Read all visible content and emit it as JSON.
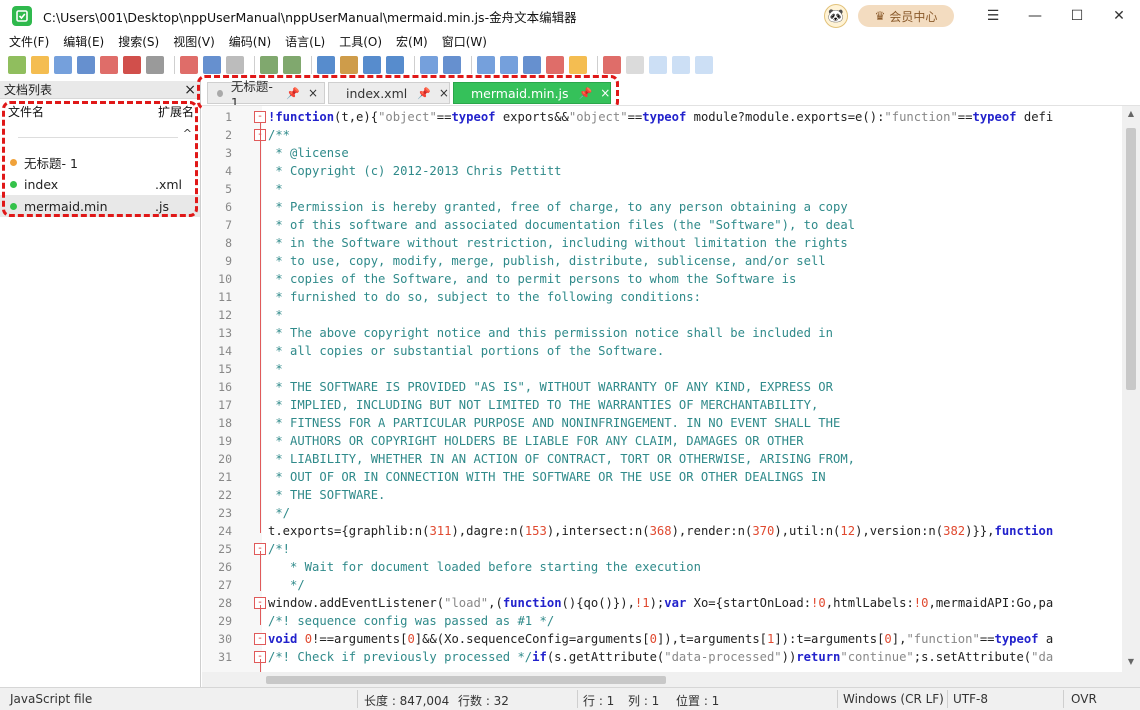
{
  "window": {
    "title": "C:\\Users\\001\\Desktop\\nppUserManual\\nppUserManual\\mermaid.min.js-金舟文本编辑器",
    "vip_label": "会员中心",
    "controls": {
      "menu": "☰",
      "minimize": "—",
      "maximize": "☐",
      "close": "✕"
    }
  },
  "menu": [
    "文件(F)",
    "编辑(E)",
    "搜索(S)",
    "视图(V)",
    "编码(N)",
    "语言(L)",
    "工具(O)",
    "宏(M)",
    "窗口(W)"
  ],
  "toolbar_icons": [
    "new-icon",
    "open-icon",
    "save-icon",
    "save-all-icon",
    "close-icon",
    "close-all-icon",
    "print-icon",
    "cut-icon",
    "copy-icon",
    "paste-icon",
    "undo-icon",
    "redo-icon",
    "find-icon",
    "replace-icon",
    "zoom-in-icon",
    "zoom-out-icon",
    "sync-icon",
    "pilcrow-icon",
    "indent-guide-icon",
    "word-wrap-icon",
    "doc-map-icon",
    "function-list-icon",
    "folder-icon",
    "record-macro-icon",
    "stop-macro-icon",
    "play-macro-icon",
    "run-macro-icon",
    "save-macro-icon"
  ],
  "doclist": {
    "title": "文档列表",
    "close": "×",
    "col_name": "文件名",
    "col_ext": "扩展名",
    "caret": "^",
    "items": [
      {
        "name": "无标题- 1",
        "ext": "",
        "status": "unsaved"
      },
      {
        "name": "index",
        "ext": ".xml",
        "status": "saved"
      },
      {
        "name": "mermaid.min",
        "ext": ".js",
        "status": "saved"
      }
    ]
  },
  "tabs": [
    {
      "label": "无标题- 1",
      "pin": "📌",
      "close": "×",
      "active": false
    },
    {
      "label": "index.xml",
      "pin": "📌",
      "close": "×",
      "active": false
    },
    {
      "label": "mermaid.min.js",
      "pin": "📌",
      "close": "×",
      "active": true
    }
  ],
  "editor_lines": [
    {
      "n": "1",
      "fold": "-",
      "parts": [
        [
          "c-kw",
          "!function"
        ],
        [
          "c-black",
          "(t,e){"
        ],
        [
          "c-str",
          "\"object\""
        ],
        [
          "c-black",
          "=="
        ],
        [
          "c-kw",
          "typeof"
        ],
        [
          "c-black",
          " exports&&"
        ],
        [
          "c-str",
          "\"object\""
        ],
        [
          "c-black",
          "=="
        ],
        [
          "c-kw",
          "typeof"
        ],
        [
          "c-black",
          " module?module.exports=e():"
        ],
        [
          "c-str",
          "\"function\""
        ],
        [
          "c-black",
          "=="
        ],
        [
          "c-kw",
          "typeof"
        ],
        [
          "c-black",
          " defi"
        ]
      ]
    },
    {
      "n": "2",
      "fold": "-",
      "parts": [
        [
          "c-cmt",
          "/**"
        ]
      ]
    },
    {
      "n": "3",
      "parts": [
        [
          "c-cmt",
          " * @license"
        ]
      ]
    },
    {
      "n": "4",
      "parts": [
        [
          "c-cmt",
          " * Copyright (c) 2012-2013 Chris Pettitt"
        ]
      ]
    },
    {
      "n": "5",
      "parts": [
        [
          "c-cmt",
          " *"
        ]
      ]
    },
    {
      "n": "6",
      "parts": [
        [
          "c-cmt",
          " * Permission is hereby granted, free of charge, to any person obtaining a copy"
        ]
      ]
    },
    {
      "n": "7",
      "parts": [
        [
          "c-cmt",
          " * of this software and associated documentation files (the \"Software\"), to deal"
        ]
      ]
    },
    {
      "n": "8",
      "parts": [
        [
          "c-cmt",
          " * in the Software without restriction, including without limitation the rights"
        ]
      ]
    },
    {
      "n": "9",
      "parts": [
        [
          "c-cmt",
          " * to use, copy, modify, merge, publish, distribute, sublicense, and/or sell"
        ]
      ]
    },
    {
      "n": "10",
      "parts": [
        [
          "c-cmt",
          " * copies of the Software, and to permit persons to whom the Software is"
        ]
      ]
    },
    {
      "n": "11",
      "parts": [
        [
          "c-cmt",
          " * furnished to do so, subject to the following conditions:"
        ]
      ]
    },
    {
      "n": "12",
      "parts": [
        [
          "c-cmt",
          " *"
        ]
      ]
    },
    {
      "n": "13",
      "parts": [
        [
          "c-cmt",
          " * The above copyright notice and this permission notice shall be included in"
        ]
      ]
    },
    {
      "n": "14",
      "parts": [
        [
          "c-cmt",
          " * all copies or substantial portions of the Software."
        ]
      ]
    },
    {
      "n": "15",
      "parts": [
        [
          "c-cmt",
          " *"
        ]
      ]
    },
    {
      "n": "16",
      "parts": [
        [
          "c-cmt",
          " * THE SOFTWARE IS PROVIDED \"AS IS\", WITHOUT WARRANTY OF ANY KIND, EXPRESS OR"
        ]
      ]
    },
    {
      "n": "17",
      "parts": [
        [
          "c-cmt",
          " * IMPLIED, INCLUDING BUT NOT LIMITED TO THE WARRANTIES OF MERCHANTABILITY,"
        ]
      ]
    },
    {
      "n": "18",
      "parts": [
        [
          "c-cmt",
          " * FITNESS FOR A PARTICULAR PURPOSE AND NONINFRINGEMENT. IN NO EVENT SHALL THE"
        ]
      ]
    },
    {
      "n": "19",
      "parts": [
        [
          "c-cmt",
          " * AUTHORS OR COPYRIGHT HOLDERS BE LIABLE FOR ANY CLAIM, DAMAGES OR OTHER"
        ]
      ]
    },
    {
      "n": "20",
      "parts": [
        [
          "c-cmt",
          " * LIABILITY, WHETHER IN AN ACTION OF CONTRACT, TORT OR OTHERWISE, ARISING FROM,"
        ]
      ]
    },
    {
      "n": "21",
      "parts": [
        [
          "c-cmt",
          " * OUT OF OR IN CONNECTION WITH THE SOFTWARE OR THE USE OR OTHER DEALINGS IN"
        ]
      ]
    },
    {
      "n": "22",
      "parts": [
        [
          "c-cmt",
          " * THE SOFTWARE."
        ]
      ]
    },
    {
      "n": "23",
      "parts": [
        [
          "c-cmt",
          " */"
        ]
      ]
    },
    {
      "n": "24",
      "parts": [
        [
          "c-black",
          "t.exports={graphlib:n("
        ],
        [
          "c-num",
          "311"
        ],
        [
          "c-black",
          "),dagre:n("
        ],
        [
          "c-num",
          "153"
        ],
        [
          "c-black",
          "),intersect:n("
        ],
        [
          "c-num",
          "368"
        ],
        [
          "c-black",
          "),render:n("
        ],
        [
          "c-num",
          "370"
        ],
        [
          "c-black",
          "),util:n("
        ],
        [
          "c-num",
          "12"
        ],
        [
          "c-black",
          "),version:n("
        ],
        [
          "c-num",
          "382"
        ],
        [
          "c-black",
          ")}},"
        ],
        [
          "c-kw",
          "function"
        ]
      ]
    },
    {
      "n": "25",
      "fold": "-",
      "parts": [
        [
          "c-cmt",
          "/*!"
        ]
      ]
    },
    {
      "n": "26",
      "parts": [
        [
          "c-cmt",
          "   * Wait for document loaded before starting the execution"
        ]
      ]
    },
    {
      "n": "27",
      "parts": [
        [
          "c-cmt",
          "   */"
        ]
      ]
    },
    {
      "n": "28",
      "fold": "-",
      "parts": [
        [
          "c-black",
          "window.addEventListener("
        ],
        [
          "c-str",
          "\"load\""
        ],
        [
          "c-black",
          ",("
        ],
        [
          "c-kw",
          "function"
        ],
        [
          "c-black",
          "(){qo()}),"
        ],
        [
          "c-num",
          "!1"
        ],
        [
          "c-black",
          ");"
        ],
        [
          "c-kw",
          "var"
        ],
        [
          "c-black",
          " Xo={startOnLoad:"
        ],
        [
          "c-num",
          "!0"
        ],
        [
          "c-black",
          ",htmlLabels:"
        ],
        [
          "c-num",
          "!0"
        ],
        [
          "c-black",
          ",mermaidAPI:Go,pa"
        ]
      ]
    },
    {
      "n": "29",
      "parts": [
        [
          "c-cmt",
          "/*! sequence config was passed as #1 */"
        ]
      ]
    },
    {
      "n": "30",
      "fold": "-",
      "parts": [
        [
          "c-kw",
          "void"
        ],
        [
          "c-black",
          " "
        ],
        [
          "c-num",
          "0"
        ],
        [
          "c-black",
          "!==arguments["
        ],
        [
          "c-num",
          "0"
        ],
        [
          "c-black",
          "]&&(Xo.sequenceConfig=arguments["
        ],
        [
          "c-num",
          "0"
        ],
        [
          "c-black",
          "]),t=arguments["
        ],
        [
          "c-num",
          "1"
        ],
        [
          "c-black",
          "]):t=arguments["
        ],
        [
          "c-num",
          "0"
        ],
        [
          "c-black",
          "],"
        ],
        [
          "c-str",
          "\"function\""
        ],
        [
          "c-black",
          "=="
        ],
        [
          "c-kw",
          "typeof"
        ],
        [
          "c-black",
          " a"
        ]
      ]
    },
    {
      "n": "31",
      "fold": "-",
      "parts": [
        [
          "c-cmt",
          "/*! Check if previously processed */"
        ],
        [
          "c-kw",
          "if"
        ],
        [
          "c-black",
          "(s.getAttribute("
        ],
        [
          "c-str",
          "\"data-processed\""
        ],
        [
          "c-black",
          "))"
        ],
        [
          "c-kw",
          "return"
        ],
        [
          "c-str",
          "\"continue\""
        ],
        [
          "c-black",
          ";s.setAttribute("
        ],
        [
          "c-str",
          "\"da"
        ]
      ]
    }
  ],
  "status": {
    "file_type": "JavaScript file",
    "length": "长度 : 847,004",
    "lines": "行数 : 32",
    "row": "行 : 1",
    "col": "列 : 1",
    "pos": "位置 : 1",
    "eol": "Windows (CR LF)",
    "encoding": "UTF-8",
    "mode": "OVR"
  }
}
